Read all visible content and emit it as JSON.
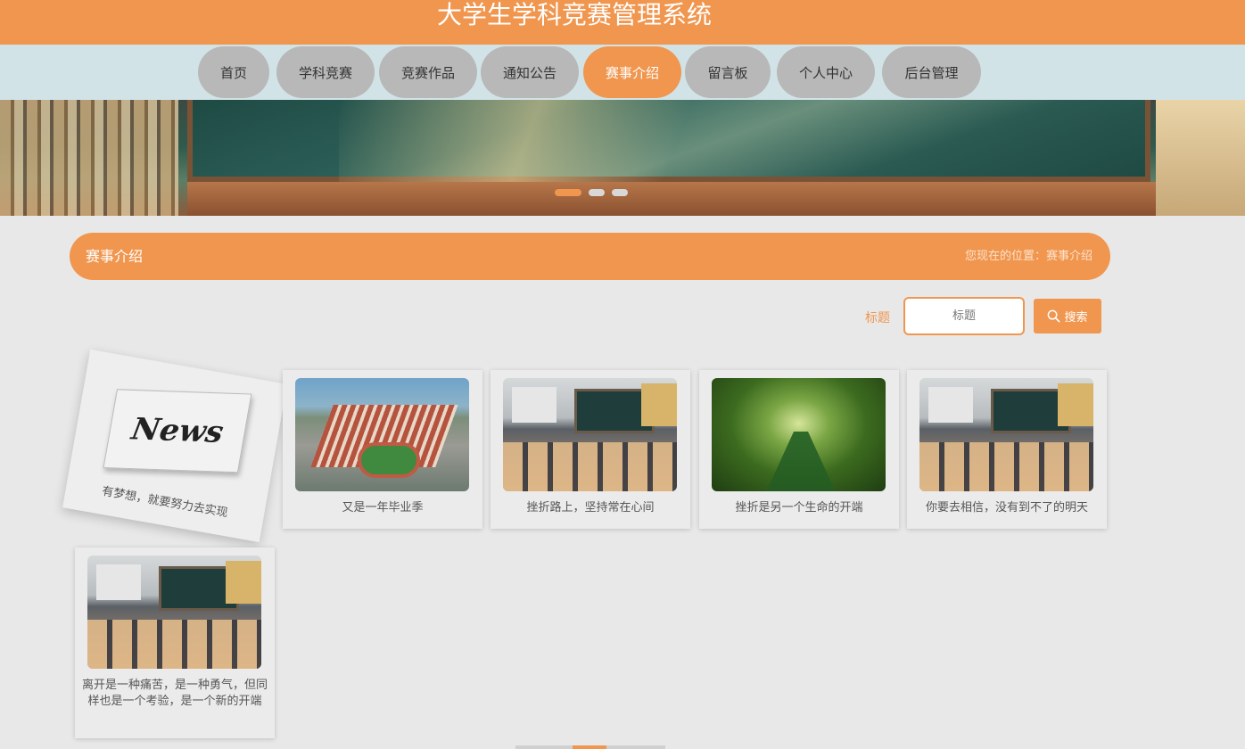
{
  "header": {
    "title": "大学生学科竞赛管理系统"
  },
  "nav": {
    "items": [
      {
        "label": "首页"
      },
      {
        "label": "学科竞赛"
      },
      {
        "label": "竞赛作品"
      },
      {
        "label": "通知公告"
      },
      {
        "label": "赛事介绍"
      },
      {
        "label": "留言板"
      },
      {
        "label": "个人中心"
      },
      {
        "label": "后台管理"
      }
    ],
    "active": "赛事介绍"
  },
  "section": {
    "title": "赛事介绍",
    "breadcrumb": "您现在的位置：赛事介绍"
  },
  "search": {
    "label": "标题",
    "placeholder": "标题",
    "button_label": "搜索"
  },
  "cards": [
    {
      "caption": "有梦想，就要努力去实现",
      "thumb": "news"
    },
    {
      "caption": "又是一年毕业季",
      "thumb": "school"
    },
    {
      "caption": "挫折路上，坚持常在心间",
      "thumb": "classroom"
    },
    {
      "caption": "挫折是另一个生命的开端",
      "thumb": "park"
    },
    {
      "caption": "你要去相信，没有到不了的明天",
      "thumb": "classroom"
    },
    {
      "caption": "离开是一种痛苦，是一种勇气，但同样也是一个考验，是一个新的开端",
      "thumb": "classroom"
    }
  ],
  "news_image_text": "News",
  "colors": {
    "accent": "#f0964f",
    "nav_bg": "#d2e3e7",
    "nav_item": "#b8b8b8",
    "page_bg": "#e8e8e8"
  },
  "icons": {
    "search": "search-icon"
  }
}
